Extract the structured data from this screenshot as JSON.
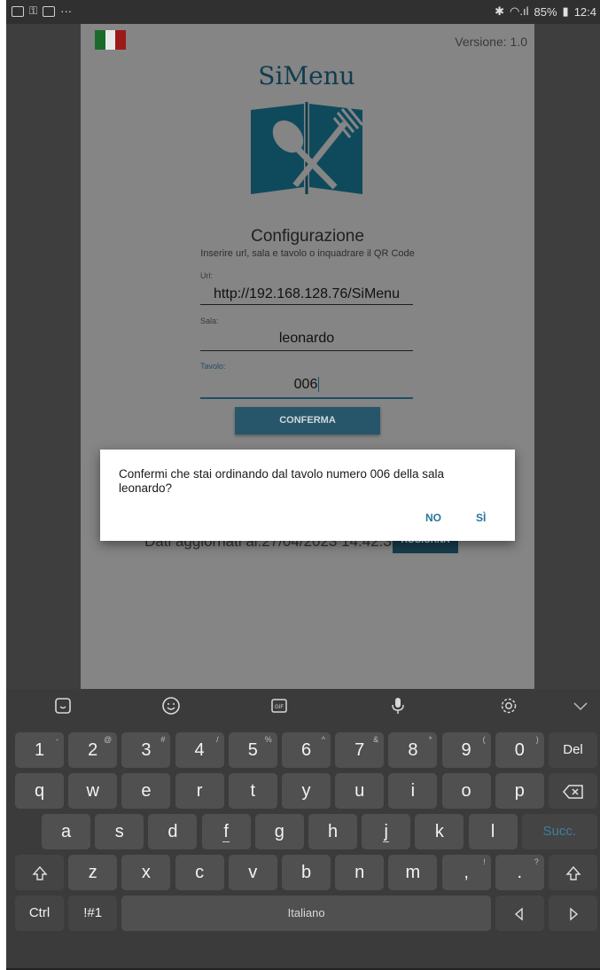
{
  "status_bar": {
    "battery": "85%",
    "time": "12:4"
  },
  "app": {
    "version": "Versione: 1.0",
    "logo_text": "SiMenu",
    "flag_colors": [
      "#1a6b2a",
      "#e8e8e8",
      "#9c1a1a"
    ],
    "config_title": "Configurazione",
    "config_subtitle": "Inserire url, sala e tavolo o inquadrare il QR Code",
    "url_label": "Url:",
    "url_value": "http://192.168.128.76/SiMenu",
    "sala_label": "Sala:",
    "sala_value": "leonardo",
    "tavolo_label": "Tavolo:",
    "tavolo_value": "006",
    "confirm_button": "CONFERMA",
    "data_updated": "Dati aggiornati al:27/04/2023 14:42:35",
    "update_button": "AGGIORNA"
  },
  "dialog": {
    "message": "Confermi che stai ordinando dal tavolo numero 006 della sala leonardo?",
    "no_button": "NO",
    "yes_button": "SÌ"
  },
  "keyboard": {
    "toolbar_icons": [
      "sticker-icon",
      "emoji-icon",
      "gif-icon",
      "microphone-icon",
      "settings-icon",
      "collapse-icon"
    ],
    "number_row": [
      {
        "k": "1",
        "s": "-"
      },
      {
        "k": "2",
        "s": "@"
      },
      {
        "k": "3",
        "s": "#"
      },
      {
        "k": "4",
        "s": "/"
      },
      {
        "k": "5",
        "s": "%"
      },
      {
        "k": "6",
        "s": "^"
      },
      {
        "k": "7",
        "s": "&"
      },
      {
        "k": "8",
        "s": "*"
      },
      {
        "k": "9",
        "s": "("
      },
      {
        "k": "0",
        "s": ")"
      }
    ],
    "del_label": "Del",
    "row_q": [
      "q",
      "w",
      "e",
      "r",
      "t",
      "y",
      "u",
      "i",
      "o",
      "p"
    ],
    "row_a": [
      "a",
      "s",
      "d",
      "f",
      "g",
      "h",
      "j",
      "k",
      "l"
    ],
    "enter_label": "Succ.",
    "row_z": [
      "z",
      "x",
      "c",
      "v",
      "b",
      "n",
      "m"
    ],
    "comma": {
      "k": ",",
      "s": "!"
    },
    "period": {
      "k": ".",
      "s": "?"
    },
    "ctrl_label": "Ctrl",
    "symbols_label": "!#1",
    "space_label": "Italiano",
    "accent": "#3f7f9b"
  }
}
